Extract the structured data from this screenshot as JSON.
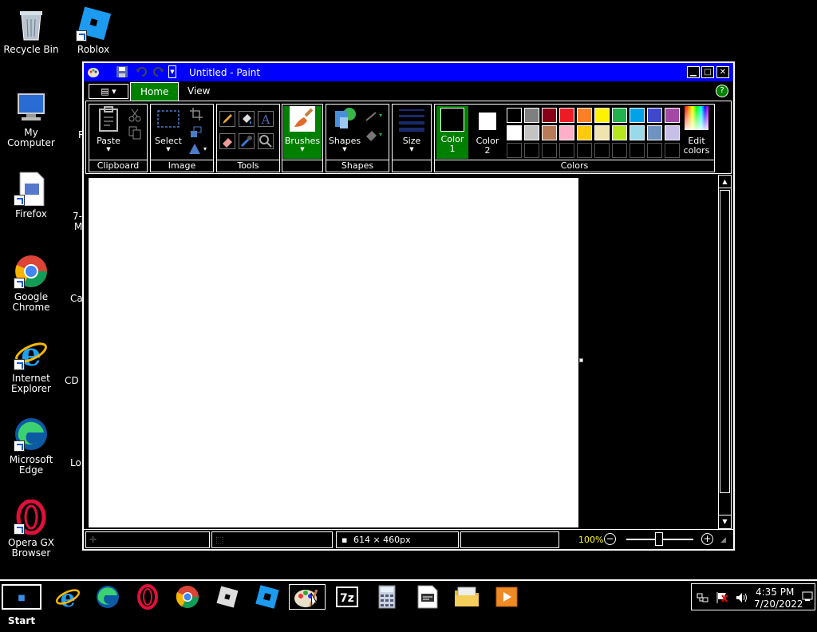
{
  "desktop": {
    "icons": [
      {
        "label": "Recycle Bin"
      },
      {
        "label": "Roblox Studio"
      },
      {
        "label": "My Computer"
      },
      {
        "label": "Firefox"
      },
      {
        "label": "Google Chrome"
      },
      {
        "label": "Internet Explorer"
      },
      {
        "label": "Microsoft Edge"
      },
      {
        "label": "Opera GX Browser"
      }
    ],
    "partial_labels": [
      "R",
      "7-",
      "M",
      "Ca",
      "CD",
      "Lo"
    ]
  },
  "paint": {
    "title": "Untitled - Paint",
    "tabs": [
      "Home",
      "View"
    ],
    "groups": {
      "clipboard": "Clipboard",
      "image": "Image",
      "tools": "Tools",
      "shapes": "Shapes",
      "colors": "Colors"
    },
    "buttons": {
      "paste": "Paste",
      "select": "Select",
      "brushes": "Brushes",
      "shapes": "Shapes",
      "size": "Size",
      "color1_a": "Color",
      "color1_b": "1",
      "color2_a": "Color",
      "color2_b": "2",
      "edit_colors_a": "Edit",
      "edit_colors_b": "colors"
    },
    "palette_row1": [
      "#000000",
      "#7f7f7f",
      "#880015",
      "#ed1c24",
      "#ff7f27",
      "#fff200",
      "#22b14c",
      "#00a2e8",
      "#3f48cc",
      "#a349a4"
    ],
    "palette_row2": [
      "#ffffff",
      "#c3c3c3",
      "#b97a57",
      "#ffaec9",
      "#ffc90e",
      "#efe4b0",
      "#b5e61d",
      "#99d9ea",
      "#7092be",
      "#c8bfe7"
    ],
    "status": {
      "dimensions": "614 × 460px",
      "zoom": "100%"
    }
  },
  "taskbar": {
    "start": "Start",
    "time": "4:35 PM",
    "date": "7/20/2022"
  }
}
